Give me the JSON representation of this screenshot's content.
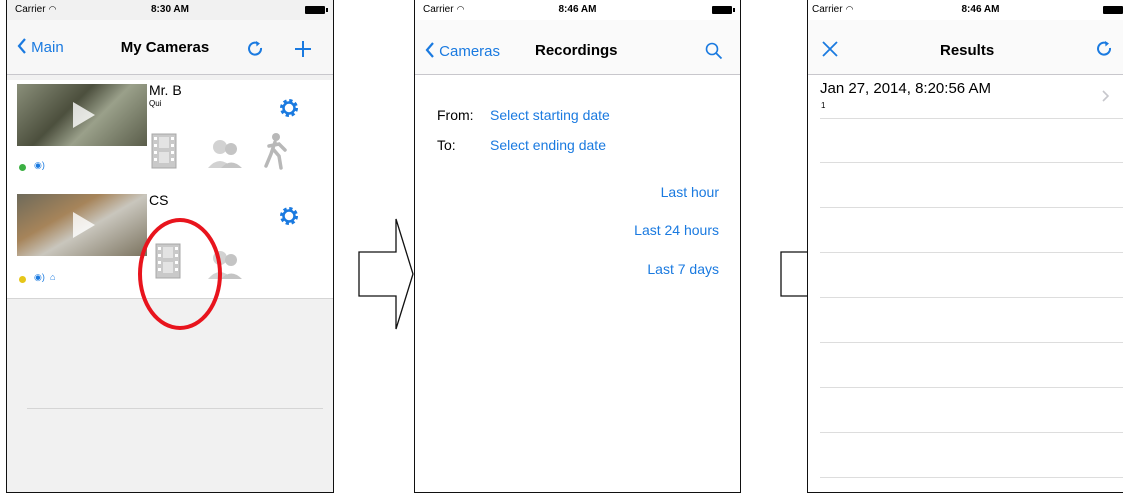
{
  "status_bar": {
    "panel1": {
      "carrier": "Carrier",
      "time": "8:30 AM"
    },
    "panel2": {
      "carrier": "Carrier",
      "time": "8:46 AM"
    },
    "panel3": {
      "carrier": "Carrier",
      "time": "8:46 AM"
    }
  },
  "cameras_screen": {
    "back_label": "Main",
    "title": "My Cameras",
    "cameras": [
      {
        "name": "Mr. B",
        "subtitle": "Qui"
      },
      {
        "name": "CS",
        "subtitle": ""
      }
    ]
  },
  "recordings_screen": {
    "back_label": "Cameras",
    "title": "Recordings",
    "from_label": "From:",
    "from_value": "Select starting date",
    "to_label": "To:",
    "to_value": "Select ending date",
    "quick_ranges": [
      "Last hour",
      "Last 24 hours",
      "Last 7 days"
    ]
  },
  "results_screen": {
    "title": "Results",
    "results": [
      {
        "timestamp": "Jan 27, 2014, 8:20:56 AM",
        "count": "1"
      }
    ]
  },
  "colors": {
    "accent": "#1a7ae0",
    "highlight": "#e8141d"
  },
  "icons": [
    "wifi-icon",
    "battery-icon",
    "back-chevron-icon",
    "refresh-icon",
    "plus-icon",
    "gear-icon",
    "film-icon",
    "people-icon",
    "motion-person-icon",
    "search-icon",
    "close-icon",
    "disclosure-chevron-icon",
    "arrow-right-icon"
  ]
}
